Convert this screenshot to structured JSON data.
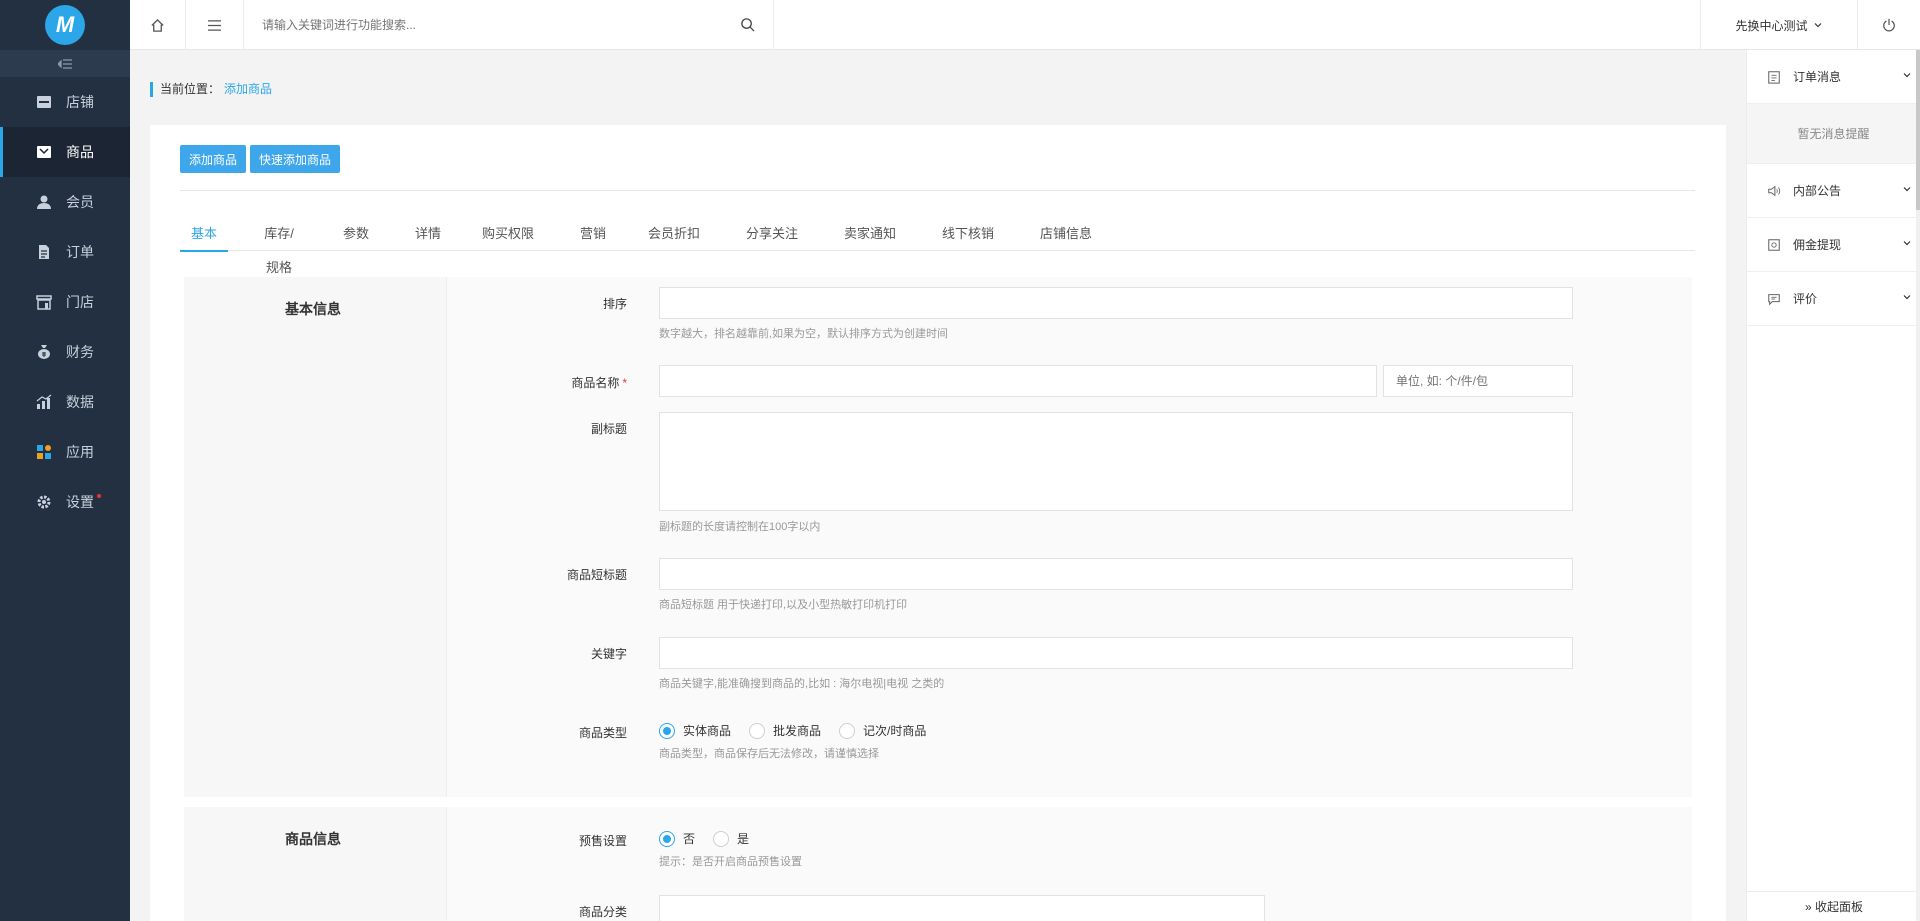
{
  "sidebar": {
    "logo_text": "M",
    "collapse_icon": "collapse-icon",
    "items": [
      {
        "label": "店铺",
        "icon": "shop-icon"
      },
      {
        "label": "商品",
        "icon": "goods-icon",
        "active": true
      },
      {
        "label": "会员",
        "icon": "member-icon"
      },
      {
        "label": "订单",
        "icon": "order-icon"
      },
      {
        "label": "门店",
        "icon": "store-icon"
      },
      {
        "label": "财务",
        "icon": "finance-icon"
      },
      {
        "label": "数据",
        "icon": "data-icon"
      },
      {
        "label": "应用",
        "icon": "apps-icon"
      },
      {
        "label": "设置",
        "icon": "settings-icon",
        "badge": true
      }
    ]
  },
  "topbar": {
    "search_placeholder": "请输入关键词进行功能搜索...",
    "store_switch": "先换中心测试"
  },
  "breadcrumb": {
    "prefix": "当前位置：",
    "current": "添加商品"
  },
  "actions": {
    "add_goods": "添加商品",
    "quick_add_goods": "快速添加商品"
  },
  "tabs": [
    "基本",
    "库存/规格",
    "参数",
    "详情",
    "购买权限",
    "营销",
    "会员折扣",
    "分享关注",
    "卖家通知",
    "线下核销",
    "店铺信息"
  ],
  "basic": {
    "title": "基本信息",
    "sort_label": "排序",
    "sort_hint": "数字越大，排名越靠前,如果为空，默认排序方式为创建时间",
    "name_label": "商品名称",
    "unit_placeholder": "单位, 如: 个/件/包",
    "subtitle_label": "副标题",
    "subtitle_hint": "副标题的长度请控制在100字以内",
    "short_title_label": "商品短标题",
    "short_title_hint": "商品短标题 用于快递打印,以及小型热敏打印机打印",
    "keyword_label": "关键字",
    "keyword_hint": "商品关键字,能准确搜到商品的,比如 : 海尔电视|电视 之类的",
    "type_label": "商品类型",
    "type_options": [
      "实体商品",
      "批发商品",
      "记次/时商品"
    ],
    "type_selected": 0,
    "type_hint": "商品类型，商品保存后无法修改，请谨慎选择"
  },
  "goods_info": {
    "title": "商品信息",
    "presale_label": "预售设置",
    "presale_options": [
      "否",
      "是"
    ],
    "presale_selected": 0,
    "presale_hint": "提示：是否开启商品预售设置",
    "category_label": "商品分类"
  },
  "right_panel": {
    "order_msg": "订单消息",
    "no_msg": "暂无消息提醒",
    "notice": "内部公告",
    "commission": "佣金提现",
    "review": "评价",
    "collapse": "» 收起面板"
  }
}
